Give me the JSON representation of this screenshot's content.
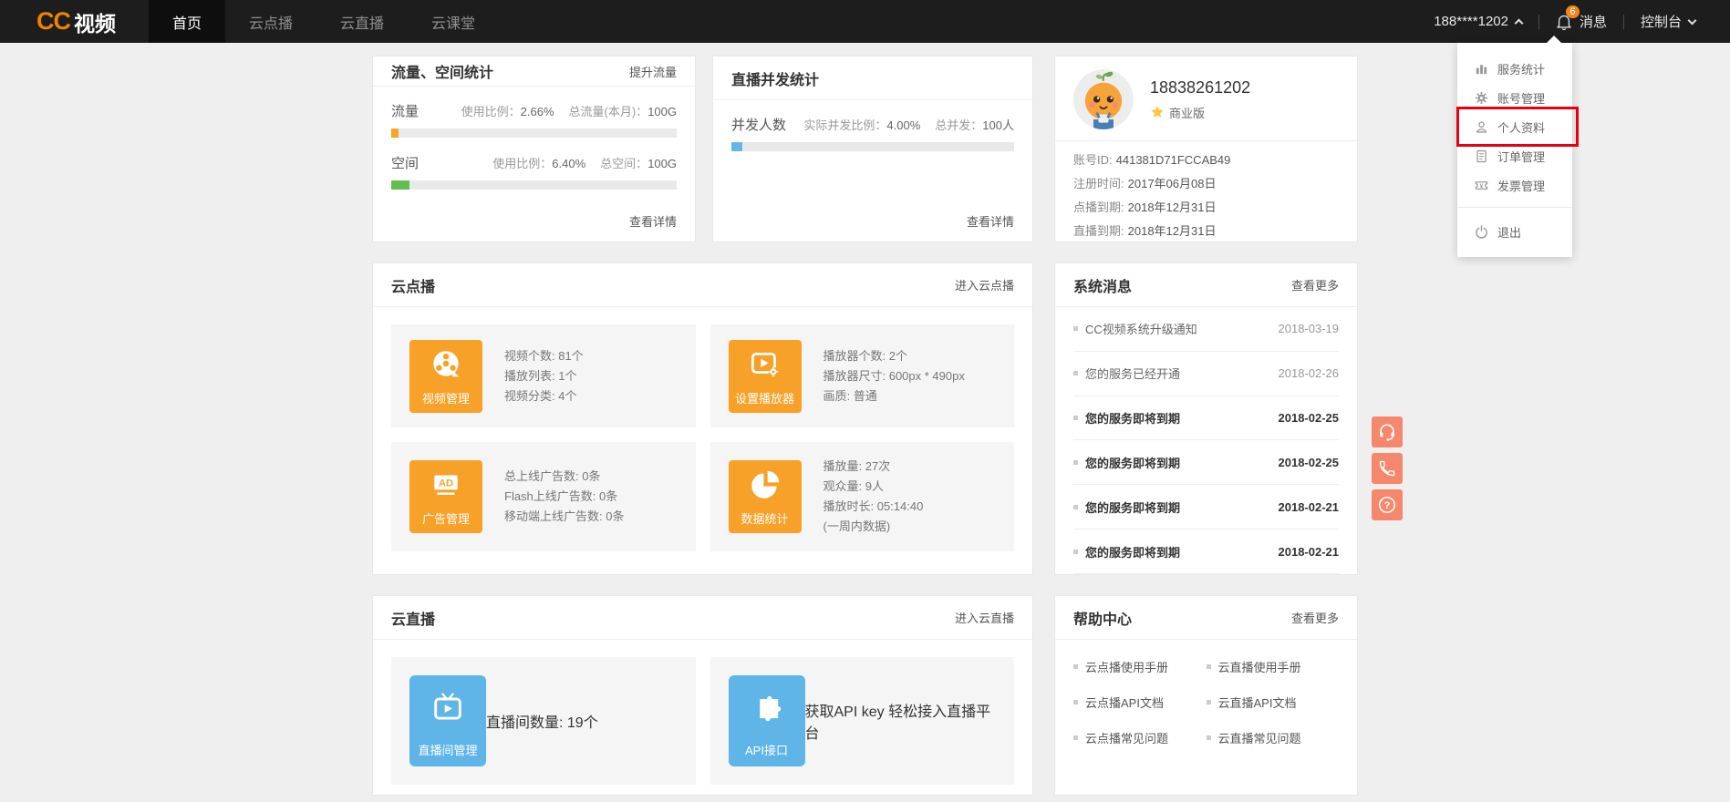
{
  "colors": {
    "accent_orange": "#f7a128",
    "accent_blue": "#5fb5e7",
    "progress_orange": "#f5a623",
    "progress_green": "#63bd52",
    "progress_blue": "#66b5e8",
    "coral": "#f5886c",
    "badge_orange": "#f08519",
    "annotation_red": "#e60012"
  },
  "navbar": {
    "logo_cc": "CC",
    "logo_zh": "视频",
    "items": [
      {
        "label": "首页"
      },
      {
        "label": "云点播"
      },
      {
        "label": "云直播"
      },
      {
        "label": "云课堂"
      }
    ],
    "user": "188****1202",
    "badge_count": "6",
    "messages_label": "消息",
    "console_label": "控制台"
  },
  "dropdown": {
    "items": [
      {
        "label": "服务统计",
        "icon": "bar-chart-icon"
      },
      {
        "label": "账号管理",
        "icon": "gear-icon"
      },
      {
        "label": "个人资料",
        "icon": "person-icon",
        "highlighted": true
      },
      {
        "label": "订单管理",
        "icon": "document-icon"
      },
      {
        "label": "发票管理",
        "icon": "ticket-icon"
      },
      {
        "label": "退出",
        "icon": "power-icon"
      }
    ]
  },
  "traffic_card": {
    "title": "流量、空间统计",
    "action": "提升流量",
    "rows": [
      {
        "label": "流量",
        "ratio_label": "使用比例：",
        "ratio_value": "2.66%",
        "total_label": "总流量(本月)：",
        "total_value": "100G"
      },
      {
        "label": "空间",
        "ratio_label": "使用比例：",
        "ratio_value": "6.40%",
        "total_label": "总空间：",
        "total_value": "100G"
      }
    ],
    "footer": "查看详情"
  },
  "concurrent_card": {
    "title": "直播并发统计",
    "row": {
      "label": "并发人数",
      "ratio_label": "实际并发比例：",
      "ratio_value": "4.00%",
      "total_label": "总并发：",
      "total_value": "100人"
    },
    "footer": "查看详情"
  },
  "account_card": {
    "phone": "18838261202",
    "plan": "商业版",
    "details": [
      {
        "label": "账号ID:",
        "value": "441381D71FCCAB49"
      },
      {
        "label": "注册时间:",
        "value": "2017年06月08日"
      },
      {
        "label": "点播到期:",
        "value": "2018年12月31日"
      },
      {
        "label": "直播到期:",
        "value": "2018年12月31日"
      }
    ]
  },
  "vod_card": {
    "title": "云点播",
    "action": "进入云点播",
    "tiles": [
      {
        "name": "视频管理",
        "icon": "film-reel-icon",
        "stats": [
          "视频个数: 81个",
          "播放列表: 1个",
          "视频分类: 4个"
        ]
      },
      {
        "name": "设置播放器",
        "icon": "player-settings-icon",
        "stats": [
          "播放器个数: 2个",
          "播放器尺寸: 600px * 490px",
          "画质: 普通"
        ]
      },
      {
        "name": "广告管理",
        "icon": "ad-icon",
        "icon_text": "AD",
        "stats": [
          "总上线广告数: 0条",
          "Flash上线广告数: 0条",
          "移动端上线广告数: 0条"
        ]
      },
      {
        "name": "数据统计",
        "icon": "pie-chart-icon",
        "stats": [
          "播放量: 27次",
          "观众量: 9人",
          "播放时长: 05:14:40",
          "(一周内数据)"
        ]
      }
    ]
  },
  "messages_card": {
    "title": "系统消息",
    "action": "查看更多",
    "items": [
      {
        "text": "CC视频系统升级通知",
        "date": "2018-03-19",
        "bold": false
      },
      {
        "text": "您的服务已经开通",
        "date": "2018-02-26",
        "bold": false
      },
      {
        "text": "您的服务即将到期",
        "date": "2018-02-25",
        "bold": true
      },
      {
        "text": "您的服务即将到期",
        "date": "2018-02-25",
        "bold": true
      },
      {
        "text": "您的服务即将到期",
        "date": "2018-02-21",
        "bold": true
      },
      {
        "text": "您的服务即将到期",
        "date": "2018-02-21",
        "bold": true
      }
    ]
  },
  "live_card": {
    "title": "云直播",
    "action": "进入云直播",
    "tiles": [
      {
        "name": "直播间管理",
        "icon": "live-room-icon",
        "stats": [
          "直播间数量: 19个"
        ]
      },
      {
        "name": "API接口",
        "icon": "puzzle-icon",
        "stats": [
          "获取API key 轻松接入直播平台"
        ]
      }
    ]
  },
  "help_card": {
    "title": "帮助中心",
    "action": "查看更多",
    "links": [
      "云点播使用手册",
      "云直播使用手册",
      "云点播API文档",
      "云直播API文档",
      "云点播常见问题",
      "云直播常见问题"
    ]
  },
  "floating": {
    "buttons": [
      {
        "icon": "headset-icon"
      },
      {
        "icon": "phone-icon"
      },
      {
        "icon": "question-icon"
      }
    ]
  }
}
